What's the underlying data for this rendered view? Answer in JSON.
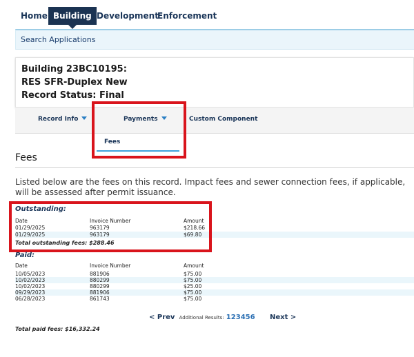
{
  "nav": {
    "home": "Home",
    "building": "Building",
    "development": "Development",
    "enforcement": "Enforcement"
  },
  "search": {
    "label": "Search Applications"
  },
  "record": {
    "line1": "Building 23BC10195:",
    "line2": "RES SFR-Duplex New",
    "line3": "Record Status: Final"
  },
  "tabs": {
    "record_info": "Record Info",
    "payments": "Payments",
    "custom": "Custom Component",
    "payments_menu_item": "Fees"
  },
  "fees": {
    "heading": "Fees",
    "description": "Listed below are the fees on this record. Impact fees and sewer connection fees, if applicable, will be assessed after permit issuance.",
    "outstanding": {
      "title": "Outstanding:",
      "headers": {
        "date": "Date",
        "invoice": "Invoice Number",
        "amount": "Amount"
      },
      "rows": [
        {
          "date": "01/29/2025",
          "invoice": "963179",
          "amount": "$218.66"
        },
        {
          "date": "01/29/2025",
          "invoice": "963179",
          "amount": "$69.80"
        }
      ],
      "total": "Total outstanding fees: $288.46"
    },
    "paid": {
      "title": "Paid:",
      "headers": {
        "date": "Date",
        "invoice": "Invoice Number",
        "amount": "Amount"
      },
      "rows": [
        {
          "date": "10/05/2023",
          "invoice": "881906",
          "amount": "$75.00"
        },
        {
          "date": "10/02/2023",
          "invoice": "880299",
          "amount": "$75.00"
        },
        {
          "date": "10/02/2023",
          "invoice": "880299",
          "amount": "$25.00"
        },
        {
          "date": "09/29/2023",
          "invoice": "881906",
          "amount": "$75.00"
        },
        {
          "date": "06/28/2023",
          "invoice": "861743",
          "amount": "$75.00"
        }
      ],
      "total": "Total paid fees: $16,332.24"
    }
  },
  "pager": {
    "prev": "< Prev",
    "additional": "Additional Results:",
    "pages": [
      "1",
      "2",
      "3",
      "4",
      "5",
      "6"
    ],
    "next": "Next >"
  },
  "colors": {
    "nav_active_bg": "#1b3352",
    "link": "#1a3558",
    "highlight_border": "#d9141c",
    "row_shade": "#eaf6fb",
    "accent_underline": "#3ca0dc"
  }
}
